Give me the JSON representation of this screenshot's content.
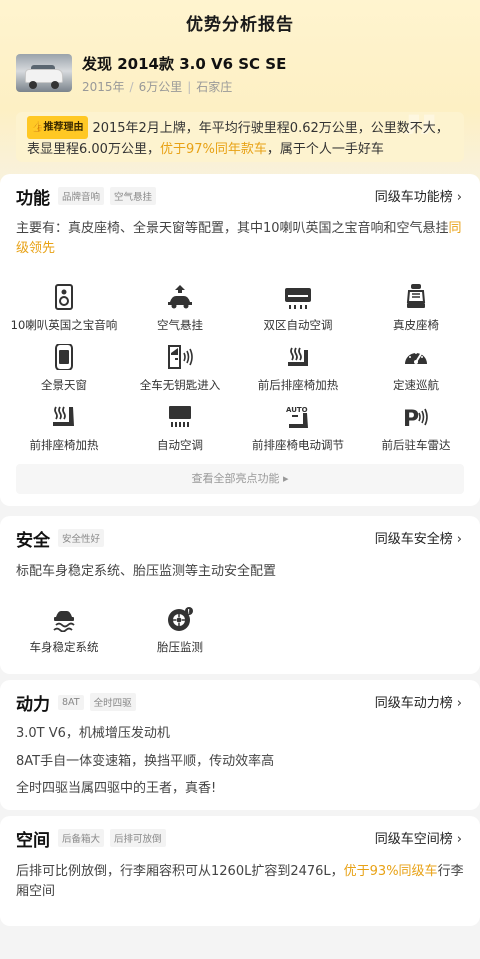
{
  "page": {
    "title": "优势分析报告"
  },
  "car": {
    "title": "发现 2014款 3.0 V6 SC SE",
    "year": "2015年",
    "mileage": "6万公里",
    "city": "石家庄"
  },
  "reason": {
    "badge": "推荐理由",
    "text_before": "2015年2月上牌，年平均行驶里程0.62万公里，公里数不大，表显里程6.00万公里，",
    "highlight": "优于97%同年款车",
    "text_after": "，属于个人一手好车"
  },
  "features": {
    "title": "功能",
    "tags": [
      "品牌音响",
      "空气悬挂"
    ],
    "rank_link": "同级车功能榜",
    "desc": "主要有：真皮座椅、全景天窗等配置，其中10喇叭英国之宝音响和空气悬挂",
    "desc_highlight": "同级领先",
    "items": [
      {
        "label": "10喇叭英国之宝音响",
        "icon": "speaker-icon"
      },
      {
        "label": "空气悬挂",
        "icon": "air-suspension-icon"
      },
      {
        "label": "双区自动空调",
        "icon": "dual-zone-ac-icon"
      },
      {
        "label": "真皮座椅",
        "icon": "leather-seat-icon"
      },
      {
        "label": "全景天窗",
        "icon": "panoramic-sunroof-icon"
      },
      {
        "label": "全车无钥匙进入",
        "icon": "keyless-entry-icon"
      },
      {
        "label": "前后排座椅加热",
        "icon": "seat-heating-icon"
      },
      {
        "label": "定速巡航",
        "icon": "cruise-control-icon"
      },
      {
        "label": "前排座椅加热",
        "icon": "front-seat-heating-icon"
      },
      {
        "label": "自动空调",
        "icon": "auto-ac-icon"
      },
      {
        "label": "前排座椅电动调节",
        "icon": "power-seat-icon"
      },
      {
        "label": "前后驻车雷达",
        "icon": "parking-radar-icon"
      }
    ],
    "more_label": "查看全部亮点功能 ▸"
  },
  "safety": {
    "title": "安全",
    "tags": [
      "安全性好"
    ],
    "rank_link": "同级车安全榜",
    "desc": "标配车身稳定系统、胎压监测等主动安全配置",
    "items": [
      {
        "label": "车身稳定系统",
        "icon": "stability-control-icon"
      },
      {
        "label": "胎压监测",
        "icon": "tire-pressure-icon"
      }
    ]
  },
  "power": {
    "title": "动力",
    "tags": [
      "8AT",
      "全时四驱"
    ],
    "rank_link": "同级车动力榜",
    "lines": [
      "3.0T V6，机械增压发动机",
      "8AT手自一体变速箱，换挡平顺，传动效率高",
      "全时四驱当属四驱中的王者，真香!"
    ]
  },
  "space": {
    "title": "空间",
    "tags": [
      "后备箱大",
      "后排可放倒"
    ],
    "rank_link": "同级车空间榜",
    "desc_before": "后排可比例放倒，行李厢容积可从1260L扩容到2476L，",
    "desc_highlight": "优于93%同级车",
    "desc_after": "行李厢空间"
  },
  "colors": {
    "accent": "#e8a216",
    "badge": "#ffc824",
    "hero": "#fdf0c4"
  }
}
